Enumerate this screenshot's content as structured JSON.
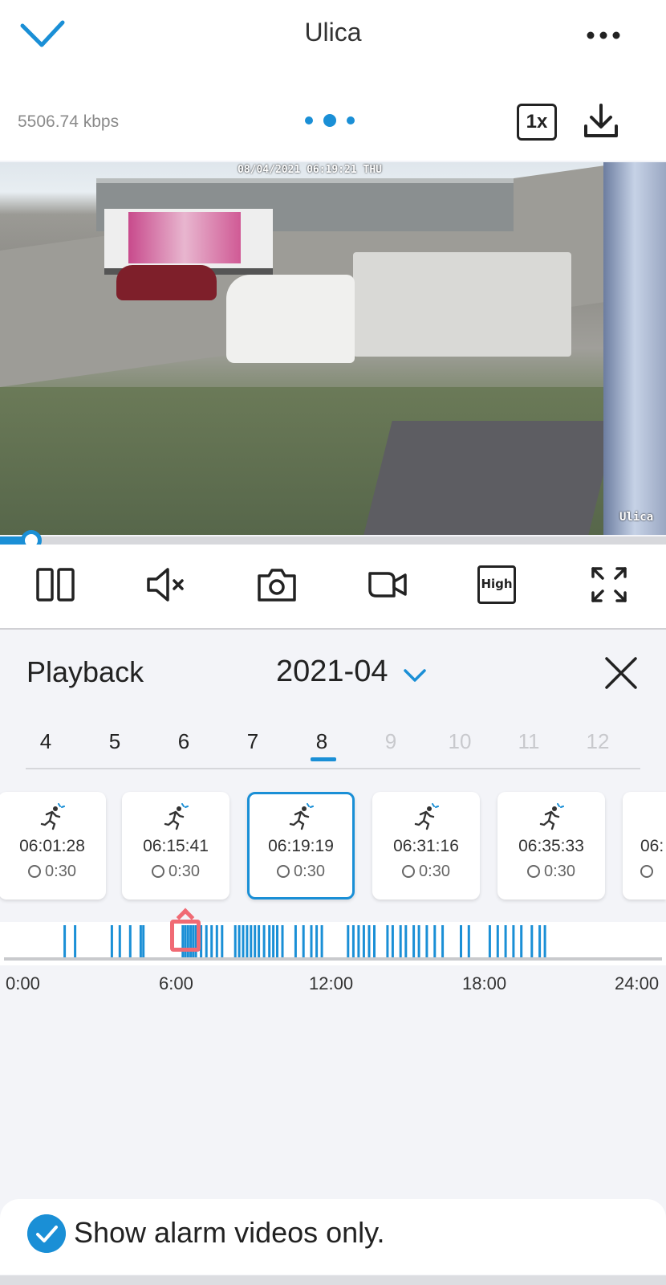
{
  "header": {
    "title": "Ulica",
    "bitrate": "5506.74 kbps",
    "speed_label": "1x"
  },
  "video": {
    "osd_timestamp": "08/04/2021 06:19:21 THU",
    "osd_name": "Ulica",
    "progress": 0.04
  },
  "controls": [
    "split-view",
    "mute",
    "snapshot",
    "record",
    "quality-high",
    "fullscreen"
  ],
  "quality_label": "High",
  "playback": {
    "title": "Playback",
    "month": "2021-04",
    "days": [
      {
        "label": "4",
        "enabled": true
      },
      {
        "label": "5",
        "enabled": true
      },
      {
        "label": "6",
        "enabled": true
      },
      {
        "label": "7",
        "enabled": true
      },
      {
        "label": "8",
        "enabled": true,
        "selected": true
      },
      {
        "label": "9",
        "enabled": false
      },
      {
        "label": "10",
        "enabled": false
      },
      {
        "label": "11",
        "enabled": false
      },
      {
        "label": "12",
        "enabled": false
      }
    ],
    "clips": [
      {
        "time": "06:01:28",
        "duration": "0:30"
      },
      {
        "time": "06:15:41",
        "duration": "0:30"
      },
      {
        "time": "06:19:19",
        "duration": "0:30",
        "selected": true
      },
      {
        "time": "06:31:16",
        "duration": "0:30"
      },
      {
        "time": "06:35:33",
        "duration": "0:30"
      },
      {
        "time": "06:",
        "duration": ""
      }
    ],
    "timeline_ticks": [
      "0:00",
      "6:00",
      "12:00",
      "18:00",
      "24:00"
    ],
    "alarm_hours": [
      1.5,
      1.9,
      3.3,
      3.6,
      4.0,
      4.4,
      4.5,
      6.0,
      6.1,
      6.2,
      6.3,
      6.4,
      6.5,
      6.7,
      6.9,
      7.1,
      7.3,
      7.5,
      8.0,
      8.15,
      8.3,
      8.45,
      8.6,
      8.75,
      8.9,
      9.1,
      9.3,
      9.45,
      9.6,
      9.8,
      10.3,
      10.6,
      10.9,
      11.1,
      11.3,
      12.3,
      12.5,
      12.7,
      12.9,
      13.1,
      13.3,
      13.8,
      14.0,
      14.3,
      14.5,
      14.8,
      15.0,
      15.3,
      15.6,
      15.9,
      16.6,
      16.9,
      17.7,
      18.0,
      18.3,
      18.6,
      18.9,
      19.3,
      19.6,
      19.8
    ]
  },
  "footer": {
    "label": "Show alarm videos only.",
    "checked": true
  },
  "colors": {
    "accent": "#1a8fd6",
    "marker": "#f06a74"
  }
}
